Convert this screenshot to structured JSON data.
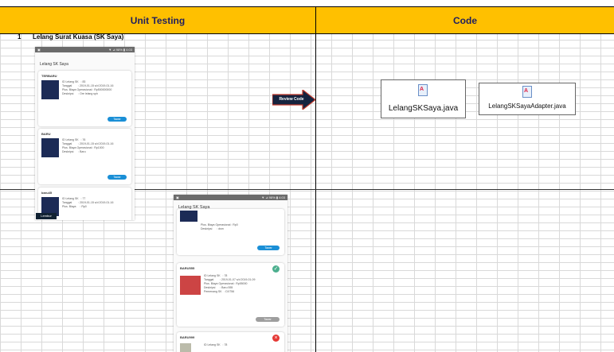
{
  "header": {
    "col1": "Unit Testing",
    "col2": "Code"
  },
  "row": {
    "number": "1",
    "title": "Lelang Surat Kuasa (SK Saya)"
  },
  "phone1": {
    "status": "▼ ⊿ 98% ▮ 4:03",
    "title": "Lelang SK Saya",
    "cards": [
      {
        "section": "TERBARU",
        "lines": "ID Lelang SK   : 83\nTanggal        : 2019-01-15 s/d 2019-01-16\nPlus. Biaya Operasional : Rp500000000\nDeskripsi      : Ore lelang sph",
        "button": "Tawar"
      },
      {
        "section": "BARU",
        "lines": "ID Lelang SK   : 76\nTanggal        : 2019-01-15 s/d 2019-01-16\nPlus. Biaya Operasional : Rp1000\nDeskripsi      : Baru",
        "button": "Tawar"
      },
      {
        "section": "baru45",
        "lines": "ID Lelang SK   : 77\nTanggal        : 2019-01-15 s/d 2019-01-16\nPlus. Biaya     : Rp0",
        "button": ""
      }
    ],
    "badge": "Lembur"
  },
  "phone2": {
    "status": "▼ ⊿ 98% ▮ 4:03",
    "title": "Lelang SK Saya",
    "card1_lines": "Plus. Biaya Operasional : Rp0\nDeskripsi      : dsm",
    "card1_button": "Tawar",
    "card2": {
      "section": "BARU555",
      "lines": "ID Lelang SK   : 78\nTanggal        : 2019-01-07 s/d 2019-01-09\nPlus. Biaya Operasional : Rp55000\nDeskripsi      : Baru 555\nPemenang SK   : DX756",
      "button": "Tawar"
    },
    "card3": {
      "section": "BARU999",
      "lines": "ID Lelang SK   : 78"
    }
  },
  "review_label": "Review Code",
  "files": [
    "LelangSKSaya.java",
    "LelangSKSayaAdapter.java"
  ]
}
